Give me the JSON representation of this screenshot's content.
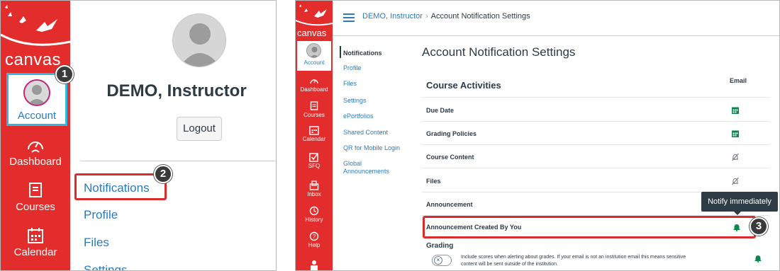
{
  "left_panel": {
    "brand": "canvas",
    "account_label": "Account",
    "nav": [
      {
        "label": "Dashboard",
        "icon": "dashboard-icon"
      },
      {
        "label": "Courses",
        "icon": "courses-icon"
      },
      {
        "label": "Calendar",
        "icon": "calendar-icon"
      }
    ],
    "user_name": "DEMO, Instructor",
    "logout_label": "Logout",
    "menu": [
      "Notifications",
      "Profile",
      "Files",
      "Settings"
    ],
    "steps": [
      "1",
      "2"
    ]
  },
  "right_panel": {
    "brand": "canvas",
    "account_label": "Account",
    "nav": [
      {
        "label": "Dashboard",
        "icon": "dashboard-icon"
      },
      {
        "label": "Courses",
        "icon": "courses-icon"
      },
      {
        "label": "Calendar",
        "icon": "calendar-icon"
      },
      {
        "label": "SFQ",
        "icon": "sfq-icon"
      },
      {
        "label": "Inbox",
        "icon": "inbox-icon"
      },
      {
        "label": "History",
        "icon": "history-icon"
      },
      {
        "label": "Help",
        "icon": "help-icon"
      }
    ],
    "breadcrumb": {
      "link": "DEMO, Instructor",
      "current": "Account Notification Settings"
    },
    "subnav": [
      "Notifications",
      "Profile",
      "Files",
      "Settings",
      "ePortfolios",
      "Shared Content",
      "QR for Mobile Login",
      "Global Announcements"
    ],
    "title": "Account Notification Settings",
    "section": "Course Activities",
    "email_col": "Email",
    "rows": [
      {
        "label": "Due Date",
        "setting": "daily"
      },
      {
        "label": "Grading Policies",
        "setting": "daily"
      },
      {
        "label": "Course Content",
        "setting": "off"
      },
      {
        "label": "Files",
        "setting": "off"
      },
      {
        "label": "Announcement",
        "setting": ""
      },
      {
        "label": "Announcement Created By You",
        "setting": "immediately"
      }
    ],
    "tooltip": "Notify immediately",
    "step": "3",
    "grading": {
      "title": "Grading",
      "toggle_text": "Include scores when alerting about grades. If your email is not an institution email this means sensitive content will be sent outside of the institution."
    },
    "colors": {
      "brand_red": "#e32d2c",
      "link_blue": "#2d7bb8",
      "notify_green": "#0b874b",
      "highlight_red": "#d92c2c",
      "focus_blue": "#2fb8dd"
    }
  }
}
